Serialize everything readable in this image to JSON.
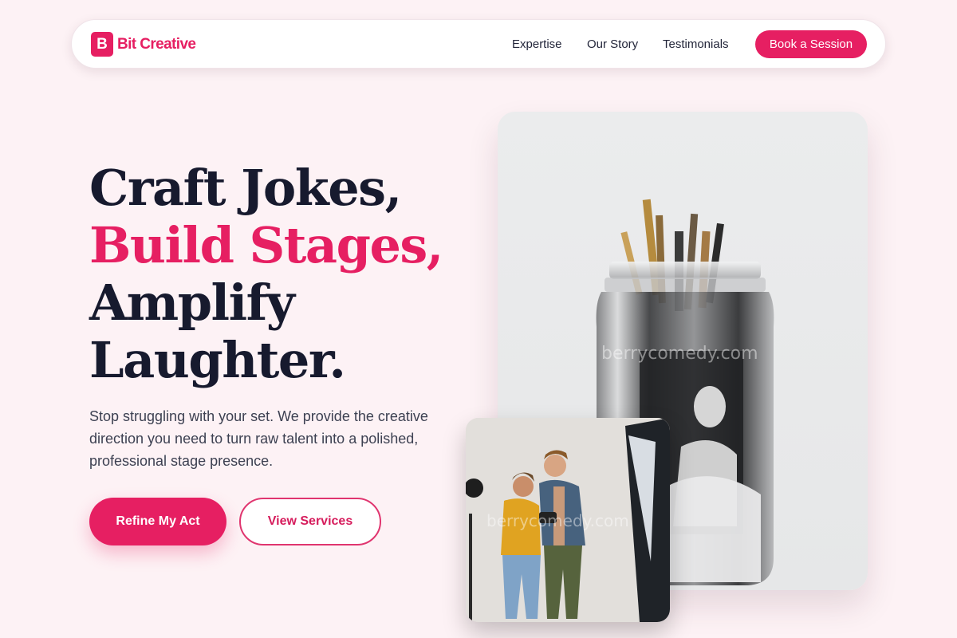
{
  "brand": {
    "mark": "B",
    "name": "Bit Creative",
    "color": "#e61f62"
  },
  "nav": {
    "links": [
      "Expertise",
      "Our Story",
      "Testimonials"
    ],
    "cta": "Book a Session"
  },
  "hero": {
    "title_lines": [
      "Craft Jokes,",
      "Build Stages,",
      "Amplify",
      "Laughter."
    ],
    "accent_line_index": 1,
    "subtitle": "Stop struggling with your set. We provide the creative direction you need to turn raw talent into a polished, professional stage presence.",
    "primary_button": "Refine My Act",
    "secondary_button": "View Services"
  },
  "images": {
    "main": {
      "icon": "paintbrush-jar-photo",
      "watermark": "berrycomedy.com"
    },
    "secondary": {
      "icon": "photoshoot-photo",
      "watermark": "berrycomedy.com"
    }
  },
  "colors": {
    "accent": "#e61f62",
    "text": "#171a2e",
    "background": "#fdf2f5"
  }
}
